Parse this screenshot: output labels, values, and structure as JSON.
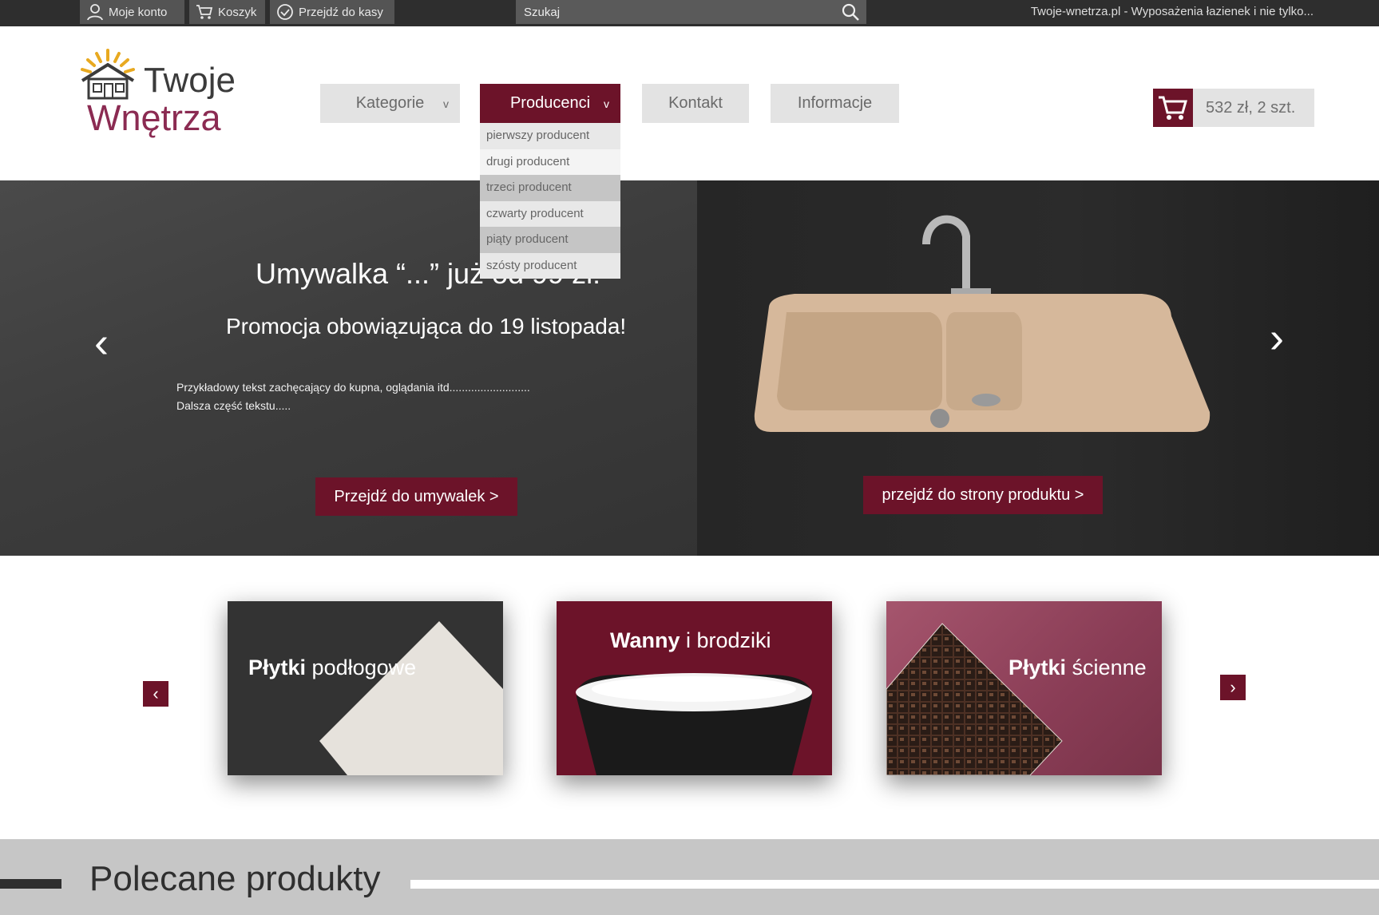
{
  "topbar": {
    "account_label": "Moje konto",
    "cart_label": "Koszyk",
    "checkout_label": "Przejdź do kasy",
    "search_placeholder": "Szukaj",
    "tagline": "Twoje-wnetrza.pl - Wyposażenia łazienek i nie tylko..."
  },
  "logo": {
    "line1": "Twoje",
    "line2": "Wnętrza"
  },
  "nav": {
    "items": [
      {
        "label": "Kategorie",
        "chevron": "v"
      },
      {
        "label": "Producenci",
        "chevron": "v"
      },
      {
        "label": "Kontakt"
      },
      {
        "label": "Informacje"
      }
    ],
    "dropdown": [
      "pierwszy producent",
      "drugi producent",
      "trzeci producent",
      "czwarty producent",
      "piąty producent",
      "szósty producent"
    ]
  },
  "cart": {
    "summary": "532 zł, 2 szt."
  },
  "hero": {
    "title": "Umywalka “...” już od 99 zł!",
    "subtitle": "Promocja obowiązująca do 19 listopada!",
    "text_line1": "Przykładowy tekst zachęcający do kupna, oglądania itd..........................",
    "text_line2": "Dalsza część tekstu.....",
    "button_left": "Przejdź do umywalek >",
    "button_right": "przejdź do strony produktu >"
  },
  "categories": [
    {
      "bold": "Płytki",
      "rest": " podłogowe"
    },
    {
      "bold": "Wanny",
      "rest": " i brodziki"
    },
    {
      "bold": "Płytki",
      "rest": " ścienne"
    }
  ],
  "featured": {
    "title": "Polecane produkty"
  },
  "colors": {
    "accent": "#6c1329",
    "topbar": "#2e2e2e",
    "nav_bg": "#e3e3e3"
  },
  "icons": [
    "user-icon",
    "cart-icon",
    "check-circle-icon",
    "search-icon",
    "chevron-left-icon",
    "chevron-right-icon"
  ]
}
